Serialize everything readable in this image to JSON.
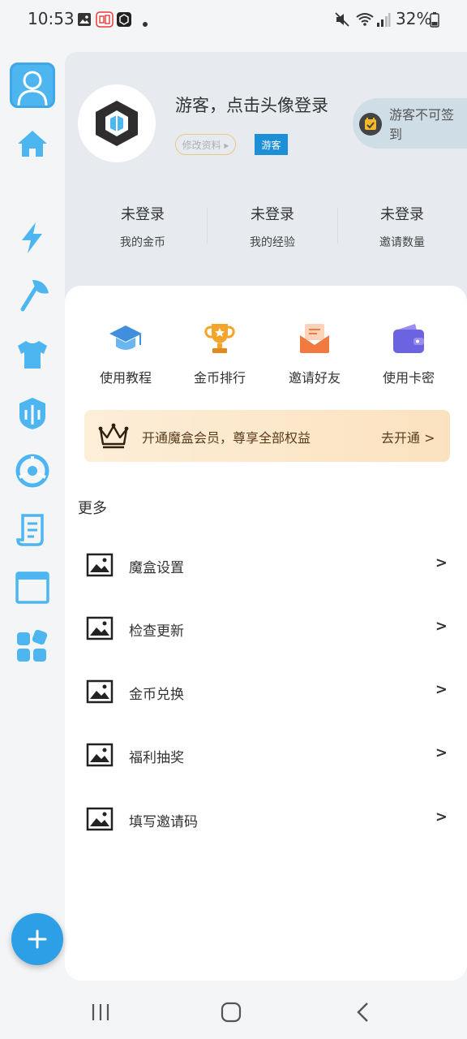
{
  "status_bar": {
    "time": "10:53",
    "battery": "32%"
  },
  "colors": {
    "accent": "#2d9fe6",
    "rail_icon": "#4db6f0",
    "header_bg": "#e7ebef",
    "guest_badge": "#1d8fd6"
  },
  "rail": {
    "items": [
      {
        "icon": "home-icon"
      },
      {
        "icon": "lightning-icon"
      },
      {
        "icon": "axe-icon"
      },
      {
        "icon": "shirt-icon"
      },
      {
        "icon": "helmet-icon"
      },
      {
        "icon": "radar-icon"
      },
      {
        "icon": "scroll-icon"
      },
      {
        "icon": "window-icon"
      },
      {
        "icon": "apps-icon"
      }
    ]
  },
  "profile": {
    "title": "游客，点击头像登录",
    "edit_label": "修改资料 ▸",
    "badge": "游客",
    "checkin_label": "游客不可签到"
  },
  "stats": [
    {
      "value": "未登录",
      "label": "我的金币"
    },
    {
      "value": "未登录",
      "label": "我的经验"
    },
    {
      "value": "未登录",
      "label": "邀请数量"
    }
  ],
  "quick_actions": [
    {
      "label": "使用教程",
      "icon": "graduation-cap-icon"
    },
    {
      "label": "金币排行",
      "icon": "trophy-icon"
    },
    {
      "label": "邀请好友",
      "icon": "mail-icon"
    },
    {
      "label": "使用卡密",
      "icon": "wallet-icon"
    }
  ],
  "vip": {
    "text": "开通魔盒会员，尊享全部权益",
    "action": "去开通 >"
  },
  "more": {
    "title": "更多",
    "items": [
      {
        "label": "魔盒设置",
        "arrow": ">"
      },
      {
        "label": "检查更新",
        "arrow": ">"
      },
      {
        "label": "金币兑换",
        "arrow": ">"
      },
      {
        "label": "福利抽奖",
        "arrow": ">"
      },
      {
        "label": "填写邀请码",
        "arrow": ">"
      }
    ]
  },
  "fab": {
    "icon": "plus-icon"
  }
}
